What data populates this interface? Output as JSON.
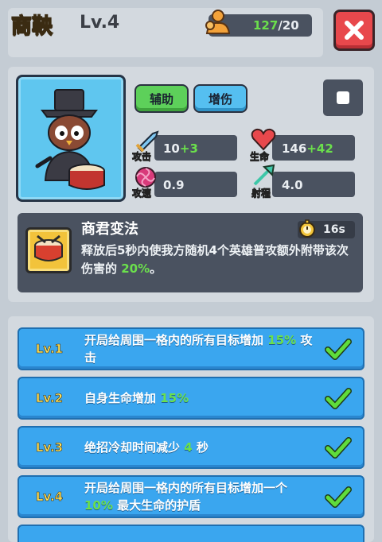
{
  "header": {
    "hero_name": "商鞅",
    "hero_level": "Lv.4",
    "resource_current": "127",
    "resource_sep_max": "/20"
  },
  "hero": {
    "tags": [
      "辅助",
      "增伤"
    ],
    "stats": {
      "attack_label": "攻击",
      "attack_value": "10",
      "attack_bonus": "+3",
      "hp_label": "生命",
      "hp_value": "146",
      "hp_bonus": "+42",
      "speed_label": "攻速",
      "speed_value": "0.9",
      "range_label": "射程",
      "range_value": "4.0"
    }
  },
  "skill": {
    "name": "商君变法",
    "cooldown": "16s",
    "desc_part1": "释放后5秒内使我方随机4个英雄普攻额外附带该次伤害的",
    "desc_highlight": "20%",
    "desc_part2": "。"
  },
  "levels": [
    {
      "lv": "Lv.1",
      "pre": "开局给周围一格内的所有目标增加",
      "hl": "15%",
      "post": "攻击"
    },
    {
      "lv": "Lv.2",
      "pre": "自身生命增加",
      "hl": "15%",
      "post": ""
    },
    {
      "lv": "Lv.3",
      "pre": "绝招冷却时间减少",
      "hl": "4",
      "post": "秒"
    },
    {
      "lv": "Lv.4",
      "pre": "开局给周围一格内的所有目标增加一个",
      "hl": "10%",
      "post": "最大生命的护盾"
    }
  ],
  "colors": {
    "accent_green": "#6be04c",
    "row_blue": "#3aa6ef",
    "close_red": "#e8484c"
  }
}
